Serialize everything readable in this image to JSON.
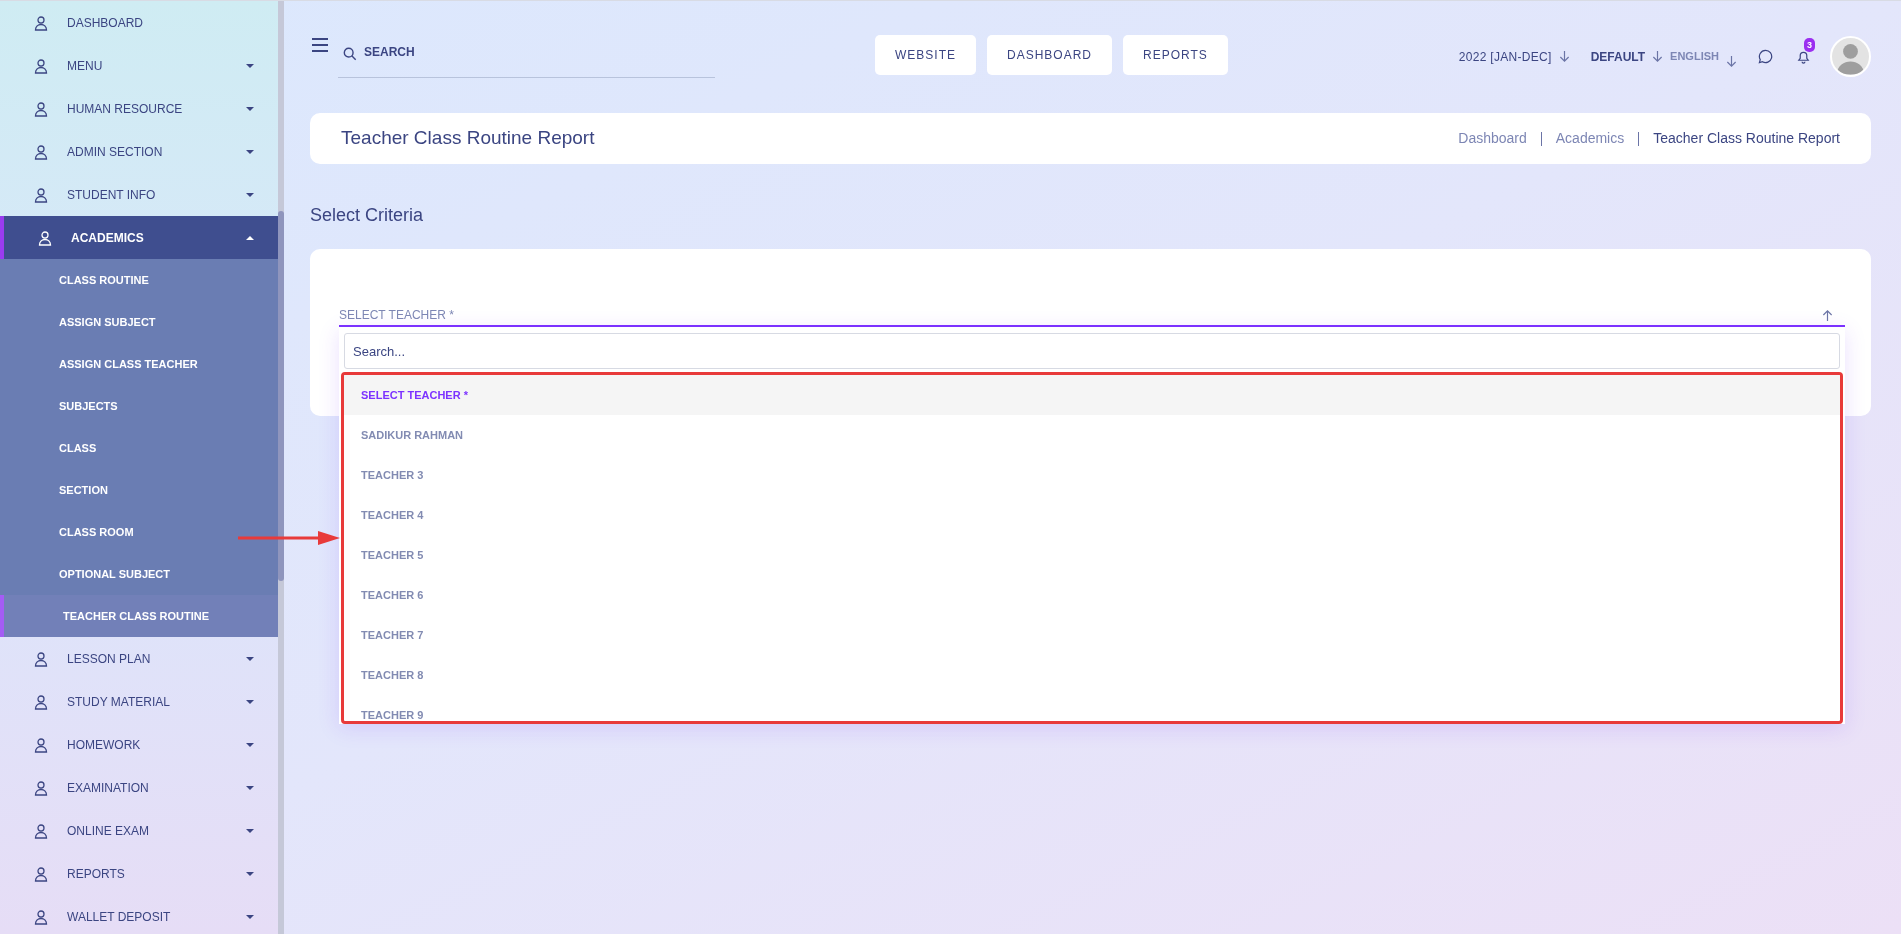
{
  "sidebar": {
    "items": [
      {
        "kind": "link",
        "label": "DASHBOARD",
        "selected": false
      },
      {
        "kind": "group",
        "label": "MENU",
        "selected": false,
        "expanded": false
      },
      {
        "kind": "group",
        "label": "HUMAN RESOURCE",
        "selected": false,
        "expanded": false
      },
      {
        "kind": "group",
        "label": "ADMIN SECTION",
        "selected": false,
        "expanded": false
      },
      {
        "kind": "group",
        "label": "STUDENT INFO",
        "selected": false,
        "expanded": false
      },
      {
        "kind": "group",
        "label": "ACADEMICS",
        "selected": true,
        "expanded": true,
        "children": [
          {
            "label": "CLASS ROUTINE",
            "selected": false
          },
          {
            "label": "ASSIGN SUBJECT",
            "selected": false
          },
          {
            "label": "ASSIGN CLASS TEACHER",
            "selected": false
          },
          {
            "label": "SUBJECTS",
            "selected": false
          },
          {
            "label": "CLASS",
            "selected": false
          },
          {
            "label": "SECTION",
            "selected": false
          },
          {
            "label": "CLASS ROOM",
            "selected": false
          },
          {
            "label": "OPTIONAL SUBJECT",
            "selected": false
          },
          {
            "label": "TEACHER CLASS ROUTINE",
            "selected": true
          }
        ]
      },
      {
        "kind": "group",
        "label": "LESSON PLAN",
        "selected": false,
        "expanded": false
      },
      {
        "kind": "group",
        "label": "STUDY MATERIAL",
        "selected": false,
        "expanded": false
      },
      {
        "kind": "group",
        "label": "HOMEWORK",
        "selected": false,
        "expanded": false
      },
      {
        "kind": "group",
        "label": "EXAMINATION",
        "selected": false,
        "expanded": false
      },
      {
        "kind": "group",
        "label": "ONLINE EXAM",
        "selected": false,
        "expanded": false
      },
      {
        "kind": "group",
        "label": "REPORTS",
        "selected": false,
        "expanded": false
      },
      {
        "kind": "group",
        "label": "WALLET DEPOSIT",
        "selected": false,
        "expanded": false
      }
    ]
  },
  "header": {
    "search": {
      "placeholder": "SEARCH"
    },
    "buttons": [
      "WEBSITE",
      "DASHBOARD",
      "REPORTS"
    ],
    "session": "2022 [JAN-DEC]",
    "style": "DEFAULT",
    "language": "ENGLISH",
    "notification_count": "3"
  },
  "page": {
    "title": "Teacher Class Routine Report",
    "breadcrumb": [
      "Dashboard",
      "Academics",
      "Teacher Class Routine Report"
    ]
  },
  "criteria": {
    "heading": "Select Criteria",
    "select": {
      "label": "SELECT TEACHER *",
      "open": true,
      "search": {
        "placeholder": "Search..."
      },
      "highlighted": true,
      "options": [
        {
          "label": "SELECT TEACHER *",
          "selected": true
        },
        {
          "label": "SADIKUR RAHMAN",
          "selected": false
        },
        {
          "label": "TEACHER 3",
          "selected": false
        },
        {
          "label": "TEACHER 4",
          "selected": false
        },
        {
          "label": "TEACHER 5",
          "selected": false
        },
        {
          "label": "TEACHER 6",
          "selected": false
        },
        {
          "label": "TEACHER 7",
          "selected": false
        },
        {
          "label": "TEACHER 8",
          "selected": false
        },
        {
          "label": "TEACHER 9",
          "selected": false
        }
      ]
    }
  }
}
